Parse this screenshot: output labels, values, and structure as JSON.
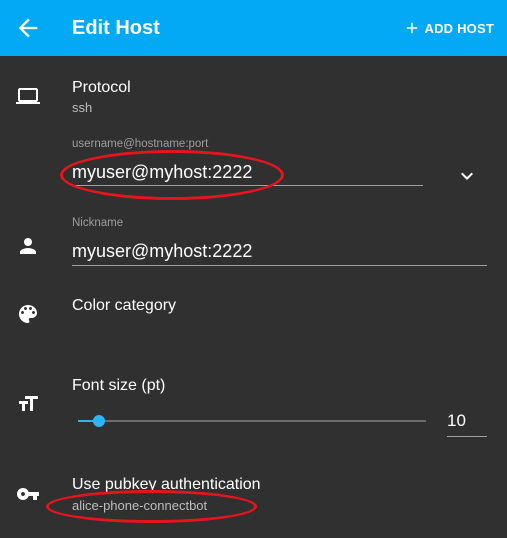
{
  "appbar": {
    "title": "Edit Host",
    "add_host_label": "ADD HOST",
    "color": "#03a9f4"
  },
  "protocol": {
    "title": "Protocol",
    "value": "ssh",
    "icon": "laptop-icon"
  },
  "uri": {
    "label": "username@hostname:port",
    "value": "myuser@myhost:2222",
    "expand_icon": "chevron-down-icon"
  },
  "nickname": {
    "label": "Nickname",
    "value": "myuser@myhost:2222",
    "icon": "person-icon"
  },
  "color_category": {
    "title": "Color category",
    "icon": "palette-icon"
  },
  "font_size": {
    "title": "Font size (pt)",
    "value": "10",
    "slider_fraction": 0.06,
    "icon": "text-size-icon",
    "accent": "#29b6f6"
  },
  "pubkey": {
    "title": "Use pubkey authentication",
    "value": "alice-phone-connectbot",
    "icon": "key-icon"
  },
  "annotation_color": "#e8141b"
}
